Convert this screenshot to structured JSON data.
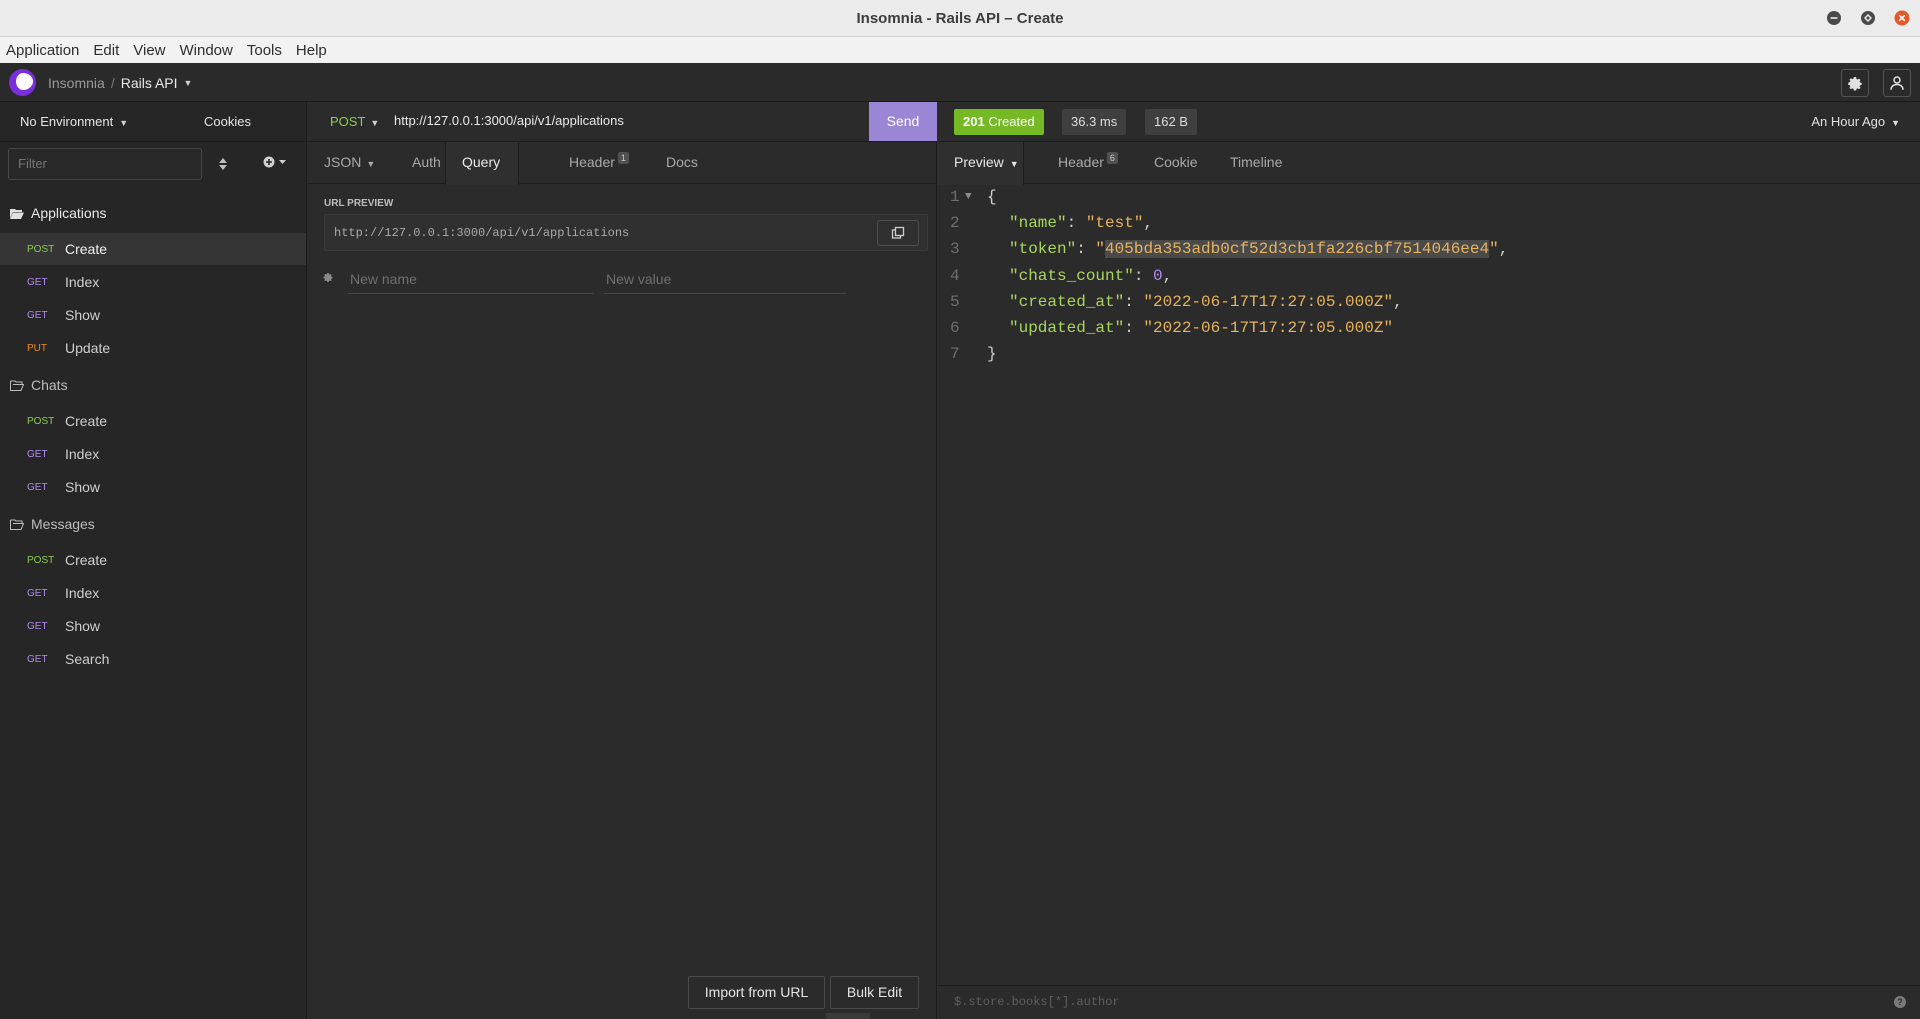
{
  "window": {
    "title": "Insomnia - Rails API – Create"
  },
  "menu": [
    "Application",
    "Edit",
    "View",
    "Window",
    "Tools",
    "Help"
  ],
  "header": {
    "workspace_root": "Insomnia",
    "separator": "/",
    "workspace": "Rails API"
  },
  "sidebar": {
    "environment": "No Environment",
    "cookies": "Cookies",
    "filter_placeholder": "Filter",
    "folders": [
      {
        "name": "Applications",
        "requests": [
          {
            "method": "POST",
            "name": "Create",
            "active": true
          },
          {
            "method": "GET",
            "name": "Index"
          },
          {
            "method": "GET",
            "name": "Show"
          },
          {
            "method": "PUT",
            "name": "Update"
          }
        ]
      },
      {
        "name": "Chats",
        "requests": [
          {
            "method": "POST",
            "name": "Create"
          },
          {
            "method": "GET",
            "name": "Index"
          },
          {
            "method": "GET",
            "name": "Show"
          }
        ]
      },
      {
        "name": "Messages",
        "requests": [
          {
            "method": "POST",
            "name": "Create"
          },
          {
            "method": "GET",
            "name": "Index"
          },
          {
            "method": "GET",
            "name": "Show"
          },
          {
            "method": "GET",
            "name": "Search"
          }
        ]
      }
    ]
  },
  "request": {
    "method": "POST",
    "url": "http://127.0.0.1:3000/api/v1/applications",
    "send_label": "Send",
    "tabs": {
      "body": "JSON",
      "auth": "Auth",
      "query": "Query",
      "header": "Header",
      "header_count": "1",
      "docs": "Docs"
    },
    "url_preview_label": "URL PREVIEW",
    "url_preview": "http://127.0.0.1:3000/api/v1/applications",
    "param_name_placeholder": "New name",
    "param_value_placeholder": "New value",
    "import_label": "Import from URL",
    "bulk_edit_label": "Bulk Edit"
  },
  "response": {
    "status": "201",
    "status_text": "Created",
    "time": "36.3 ms",
    "size": "162 B",
    "when": "An Hour Ago",
    "tabs": {
      "preview": "Preview",
      "header": "Header",
      "header_count": "6",
      "cookie": "Cookie",
      "timeline": "Timeline"
    },
    "line_numbers": [
      "1",
      "2",
      "3",
      "4",
      "5",
      "6",
      "7"
    ],
    "body": {
      "open": "{",
      "close": "}",
      "name_key": "\"name\"",
      "name_val": "\"test\"",
      "token_key": "\"token\"",
      "token_val": "405bda353adb0cf52d3cb1fa226cbf7514046ee4",
      "chats_key": "\"chats_count\"",
      "chats_val": "0",
      "created_key": "\"created_at\"",
      "created_val": "\"2022-06-17T17:27:05.000Z\"",
      "updated_key": "\"updated_at\"",
      "updated_val": "\"2022-06-17T17:27:05.000Z\""
    },
    "filter_placeholder": "$.store.books[*].author",
    "help": "?"
  },
  "colors": {
    "accent": "#9b86d6",
    "status_ok": "#75ba24",
    "post": "#8acc52",
    "get": "#b48bf0",
    "put": "#ec8a2c"
  }
}
